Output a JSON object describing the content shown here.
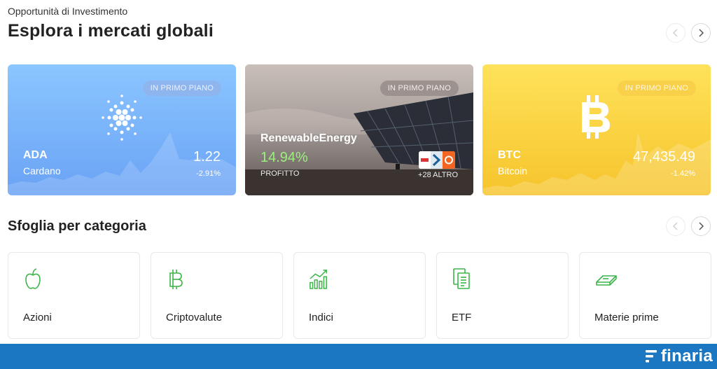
{
  "header": {
    "overline": "Opportunità di Investimento",
    "title": "Esplora i mercati globali"
  },
  "featured": {
    "cards": [
      {
        "badge": "IN PRIMO PIANO",
        "symbol": "ADA",
        "name": "Cardano",
        "price": "1.22",
        "change": "-2.91%",
        "icon": "cardano-icon"
      },
      {
        "badge": "IN PRIMO PIANO",
        "symbol": "RenewableEnergy",
        "percent": "14.94%",
        "percent_label": "PROFITTO",
        "more": "+28 ALTRO",
        "icon": "solar-panel-image"
      },
      {
        "badge": "IN PRIMO PIANO",
        "symbol": "BTC",
        "name": "Bitcoin",
        "price": "47,435.49",
        "change": "-1.42%",
        "icon": "bitcoin-icon"
      }
    ]
  },
  "categories": {
    "title": "Sfoglia per categoria",
    "items": [
      {
        "label": "Azioni",
        "icon": "apple-icon"
      },
      {
        "label": "Criptovalute",
        "icon": "bitcoin-icon"
      },
      {
        "label": "Indici",
        "icon": "bar-chart-icon"
      },
      {
        "label": "ETF",
        "icon": "documents-icon"
      },
      {
        "label": "Materie prime",
        "icon": "gold-bar-icon"
      }
    ]
  },
  "footer": {
    "brand": "finaria"
  },
  "colors": {
    "accent_green": "#3cb548",
    "footer_blue": "#1c77c3",
    "positive": "#9cef7e"
  }
}
